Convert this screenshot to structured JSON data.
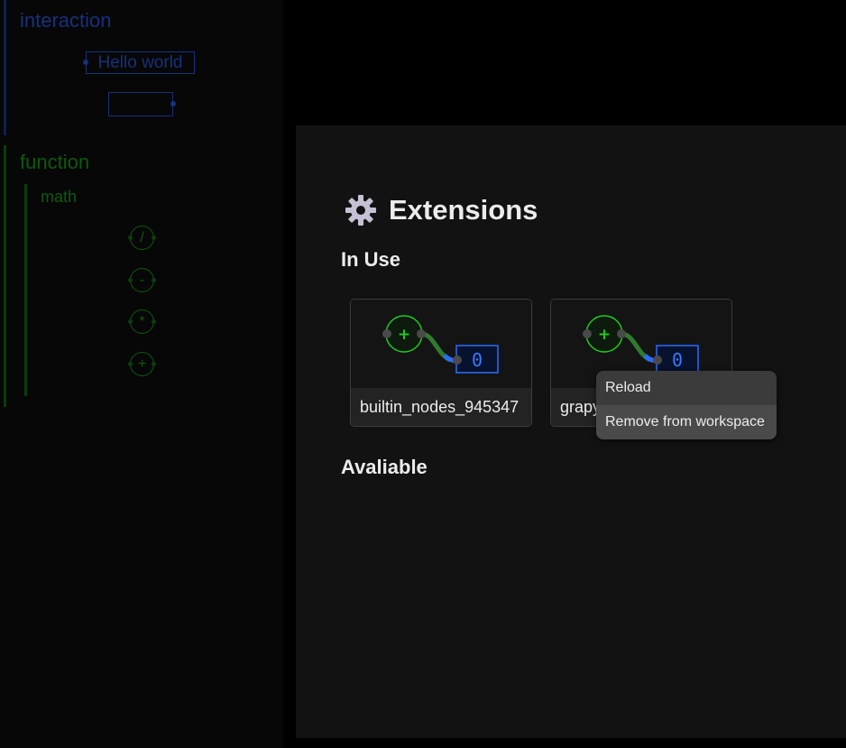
{
  "sidebar": {
    "categories": [
      {
        "name": "interaction",
        "color": "#17317c",
        "nodes": [
          "Hello world",
          ""
        ]
      },
      {
        "name": "function",
        "color": "#0e5a0e",
        "subcategories": [
          {
            "name": "math",
            "operators": [
              "/",
              "-",
              "*",
              "+"
            ]
          }
        ]
      }
    ]
  },
  "modal": {
    "icon": "gear-icon",
    "title": "Extensions",
    "sections": {
      "in_use": "In Use",
      "available": "Avaliable"
    },
    "extensions": [
      {
        "name": "builtin_nodes_945347",
        "thumb_value": "0"
      },
      {
        "name": "grapy",
        "thumb_value": "0"
      }
    ]
  },
  "context_menu": {
    "items": [
      {
        "label": "Reload"
      },
      {
        "label": "Remove from workspace"
      }
    ]
  },
  "colors": {
    "green_node": "#1ecb1e",
    "blue_node": "#2a6cff",
    "modal_bg": "#121212",
    "menu_bg": "#3b3b3b"
  }
}
